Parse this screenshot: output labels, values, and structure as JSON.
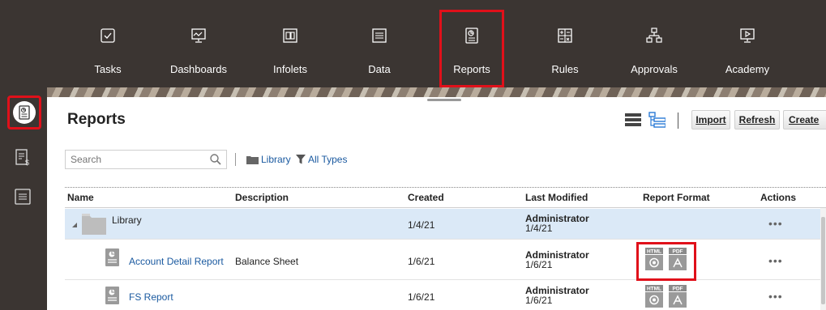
{
  "nav": {
    "items": [
      {
        "label": "Tasks",
        "icon": "tasks-icon"
      },
      {
        "label": "Dashboards",
        "icon": "dashboards-icon"
      },
      {
        "label": "Infolets",
        "icon": "infolets-icon"
      },
      {
        "label": "Data",
        "icon": "data-icon"
      },
      {
        "label": "Reports",
        "icon": "reports-icon",
        "active": true
      },
      {
        "label": "Rules",
        "icon": "rules-icon"
      },
      {
        "label": "Approvals",
        "icon": "approvals-icon"
      },
      {
        "label": "Academy",
        "icon": "academy-icon"
      }
    ]
  },
  "sidebar": {
    "items": [
      {
        "icon": "reports-icon",
        "active": true
      },
      {
        "icon": "financial-report-icon"
      },
      {
        "icon": "document-icon"
      }
    ]
  },
  "page": {
    "title": "Reports"
  },
  "toolbar": {
    "import": "Import",
    "refresh_r": "R",
    "refresh_rest": "efresh",
    "create": "Create"
  },
  "filter": {
    "search_placeholder": "Search",
    "library": "Library",
    "types": "All Types"
  },
  "table": {
    "columns": [
      "Name",
      "Description",
      "Created",
      "Last Modified",
      "Report Format",
      "Actions"
    ],
    "rows": [
      {
        "name": "Library",
        "description": "",
        "created": "1/4/21",
        "modified_by": "Administrator",
        "modified_on": "1/4/21",
        "actions": "•••"
      },
      {
        "name": "Account Detail Report",
        "description": "Balance Sheet",
        "created": "1/6/21",
        "modified_by": "Administrator",
        "modified_on": "1/6/21",
        "actions": "•••"
      },
      {
        "name": "FS Report",
        "description": "",
        "created": "1/6/21",
        "modified_by": "Administrator",
        "modified_on": "1/6/21",
        "actions": "•••"
      }
    ],
    "format_labels": {
      "html": "HTML",
      "pdf": "PDF"
    }
  },
  "colors": {
    "topbar": "#3b3532",
    "link": "#1b5aa0",
    "highlight": "#e0101a",
    "selected_row": "#dbe9f7"
  }
}
